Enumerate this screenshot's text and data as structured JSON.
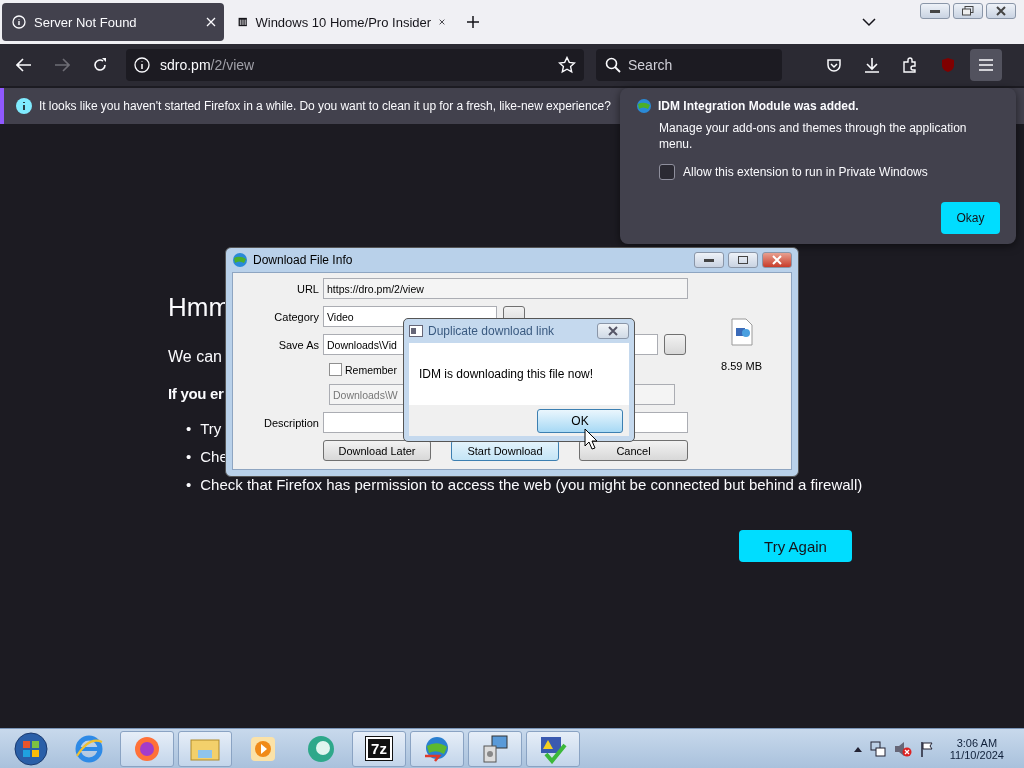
{
  "browser": {
    "tabs": [
      {
        "label": "Server Not Found",
        "selected": true
      },
      {
        "label": "Windows 10 Home/Pro Insider",
        "selected": false
      }
    ],
    "address": "sdro.pm",
    "address_path": "/2/view",
    "search_placeholder": "Search",
    "notification": "It looks like you haven't started Firefox in a while. Do you want to clean it up for a fresh, like-new experience?"
  },
  "page": {
    "heading": "Hmm",
    "lead": "We can",
    "bold_line": "If you er",
    "bullet_marker": "•",
    "bullets": [
      "Try",
      "Che",
      "Check that Firefox has permission to access the web (you might be connected but behind a firewall)"
    ],
    "button": "Try Again"
  },
  "extension_popup": {
    "title": "IDM Integration Module was added.",
    "body": "Manage your add-ons and themes through the application menu.",
    "checkbox": {
      "label": "Allow this extension to run in Private Windows",
      "checked": false
    },
    "button": "Okay"
  },
  "download_window": {
    "title": "Download File Info",
    "url_label": "URL",
    "url": "https://dro.pm/2/view",
    "category_label": "Category",
    "category": "Video",
    "save_label": "Save As",
    "save_path": "Downloads\\Vid",
    "remember": {
      "label": "Remember",
      "checked": false
    },
    "folder": "Downloads\\W",
    "description_label": "Description",
    "size": "8.59 MB",
    "buttons": [
      {
        "label": "Download Later",
        "selected": false
      },
      {
        "label": "Start Download",
        "selected": true
      },
      {
        "label": "Cancel",
        "selected": false
      }
    ]
  },
  "alert": {
    "title": "Duplicate download link",
    "message": "IDM is downloading this file now!",
    "button": "OK"
  },
  "taskbar": {
    "archiver_label": "7z",
    "time": "3:06 AM",
    "date": "11/10/2024"
  }
}
